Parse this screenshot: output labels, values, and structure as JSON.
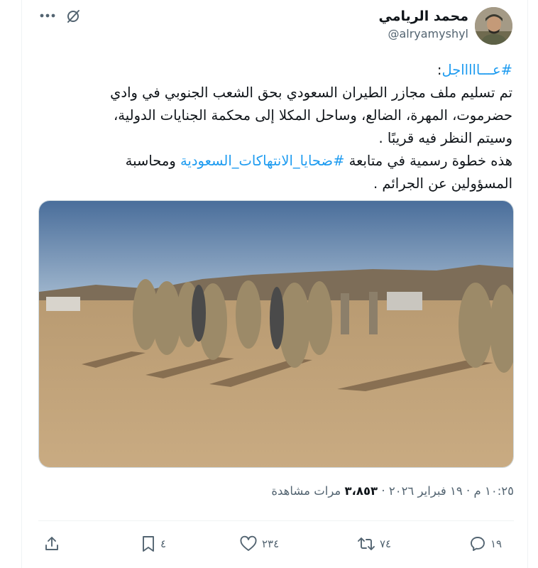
{
  "author": {
    "display_name": "محمد الريامي",
    "handle": "@alryamyshyl"
  },
  "tweet": {
    "hashtag_1": "#عـــاااااجل",
    "colon": ":",
    "line_2": "تم تسليم ملف مجازر الطيران السعودي بحق الشعب الجنوبي في وادي",
    "line_3": "حضرموت، المهرة، الضالع، وساحل المكلا إلى محكمة الجنايات الدولية،",
    "line_4": "وسيتم النظر فيه قريبًا .",
    "line_5_before": "هذه خطوة رسمية في متابعة ",
    "hashtag_2": "#ضحايا_الانتهاكات_السعودية",
    "line_5_after": " ومحاسبة",
    "line_6": "المسؤولين عن الجرائم ."
  },
  "meta": {
    "timestamp": "١٠:٢٥ م · ١٩ فبراير ٢٠٢٦ · ",
    "views_count": "٣،٨٥٣",
    "views_label": " مرات مشاهدة"
  },
  "actions": {
    "replies": "١٩",
    "retweets": "٧٤",
    "likes": "٢٣٤",
    "bookmarks": "٤"
  },
  "icons": {
    "more": "more-icon",
    "grok": "grok-icon",
    "reply": "reply-icon",
    "retweet": "retweet-icon",
    "like": "like-icon",
    "bookmark": "bookmark-icon",
    "share": "share-icon"
  },
  "colors": {
    "accent": "#1d9bf0",
    "text": "#0f1419",
    "secondary": "#536471"
  }
}
